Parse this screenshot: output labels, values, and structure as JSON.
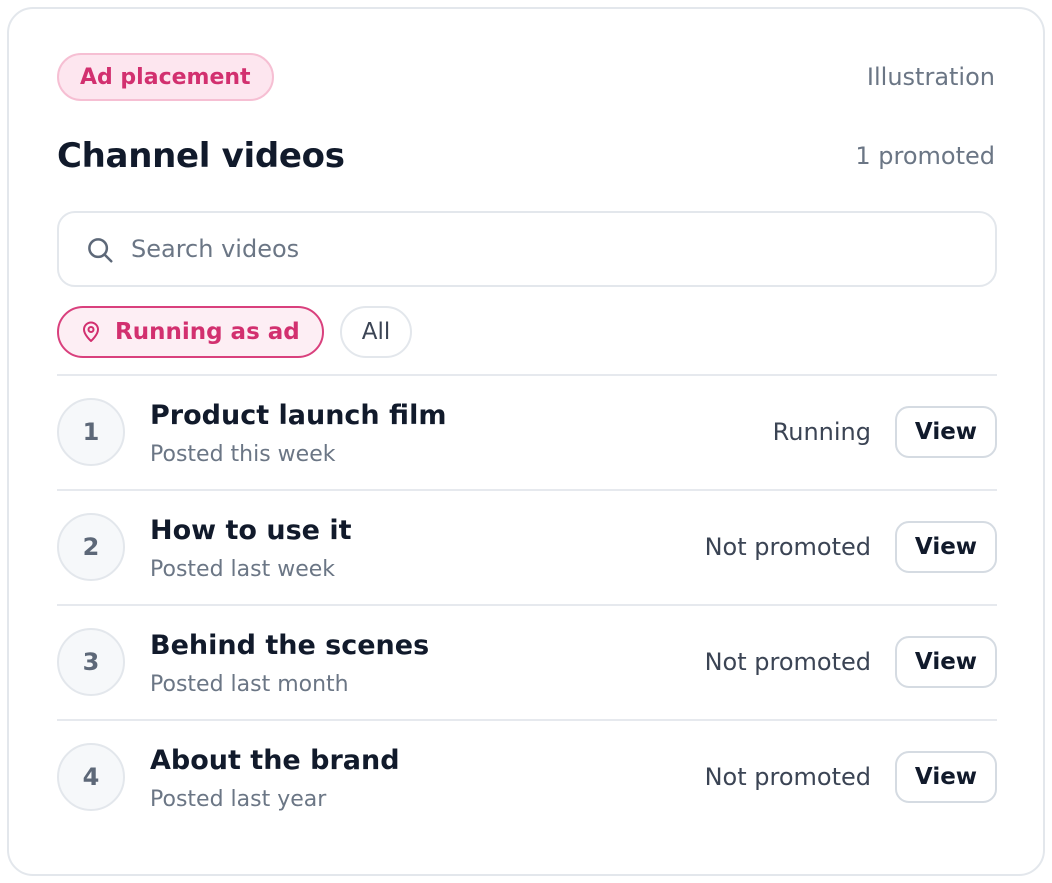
{
  "header": {
    "badge": "Ad placement",
    "illustration_label": "Illustration",
    "title": "Channel videos",
    "promoted_count": "1 promoted"
  },
  "search": {
    "placeholder": "Search videos",
    "value": ""
  },
  "filters": {
    "running_as_ad": "Running as ad",
    "all": "All",
    "selected": "Running as ad"
  },
  "videos": [
    {
      "number": "1",
      "title": "Product launch film",
      "posted": "Posted this week",
      "status": "Running",
      "action": "View"
    },
    {
      "number": "2",
      "title": "How to use it",
      "posted": "Posted last week",
      "status": "Not promoted",
      "action": "View"
    },
    {
      "number": "3",
      "title": "Behind the scenes",
      "posted": "Posted last month",
      "status": "Not promoted",
      "action": "View"
    },
    {
      "number": "4",
      "title": "About the brand",
      "posted": "Posted last year",
      "status": "Not promoted",
      "action": "View"
    }
  ],
  "colors": {
    "accent": "#d2306f",
    "accent_bg": "#fde6ef",
    "text_primary": "#111a2b",
    "text_muted": "#6b7685",
    "border": "#e3e7ec"
  },
  "icons": {
    "search": "search-icon",
    "filter_active": "map-pin-icon"
  }
}
